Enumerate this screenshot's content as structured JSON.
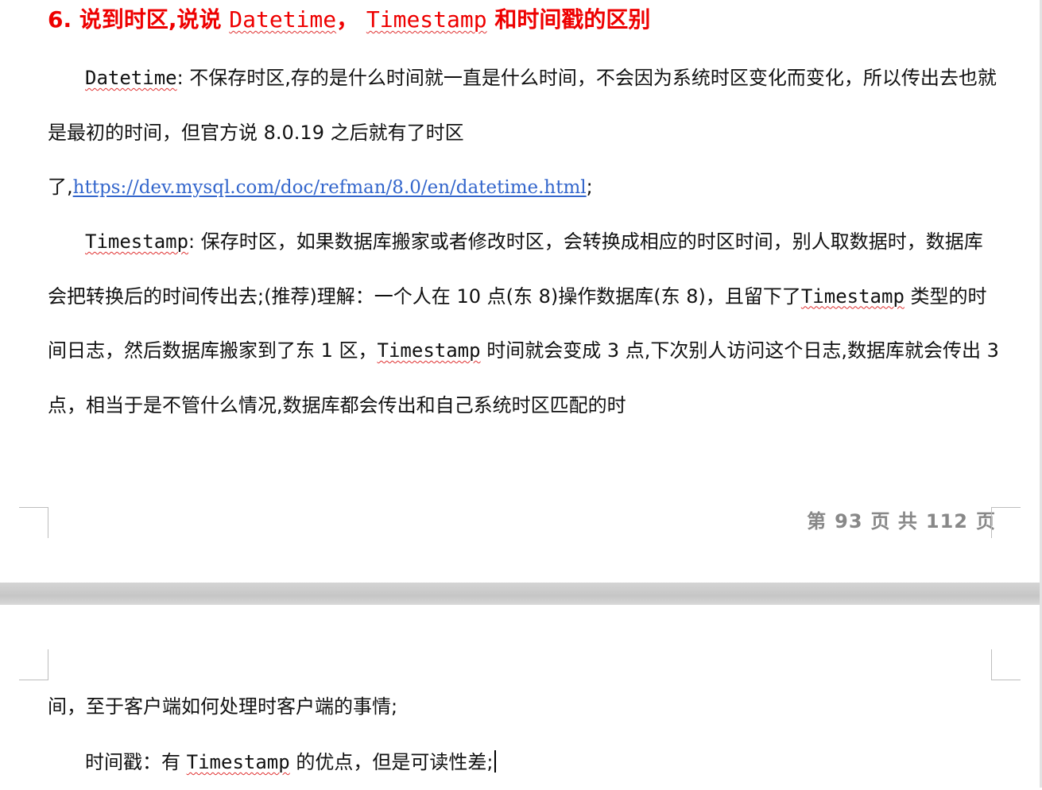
{
  "heading": {
    "number": "6. ",
    "t1": "说到时区,说说 ",
    "c1": "Datetime",
    "t2": "， ",
    "c2": "Timestamp",
    "t3": " 和时间戳的区别"
  },
  "para1": {
    "c1": "Datetime",
    "t1": ": 不保存时区,存的是什么时间就一直是什么时间，不会因为系统时区变化而变化，所以传出去也就是最初的时间，但官方说 8.0.19 之后就有了时区"
  },
  "para2": {
    "t1": "了,",
    "link": "https://dev.mysql.com/doc/refman/8.0/en/datetime.html",
    "t2": ";"
  },
  "para3": {
    "c1": "Timestamp",
    "t1": ": 保存时区，如果数据库搬家或者修改时区，会转换成相应的时区时间，别人取数据时，数据库会把转换后的时间传出去;(推荐)理解：一个人在 10 点(东 8)操作数据库(东 8)，且留下了",
    "c2": "Timestamp",
    "t2": " 类型的时间日志，然后数据库搬家到了东 1 区，",
    "c3": "Timestamp",
    "t3": " 时间就会变成 3 点,下次别人访问这个日志,数据库就会传出 3 点，相当于是不管什么情况,数据库都会传出和自己系统时区匹配的时"
  },
  "footer": {
    "prefix": "第",
    "page": "93",
    "mid": "页 共",
    "total": "112",
    "suffix": "页"
  },
  "para4": {
    "t1": "间，至于客户端如何处理时客户端的事情;"
  },
  "para5": {
    "t1": "时间戳：有 ",
    "c1": "Timestamp",
    "t2": " 的优点，但是可读性差;"
  },
  "colors": {
    "heading": "#ee0000",
    "link": "#3366cc",
    "footer": "#888888",
    "page_gap": "#cccccc"
  }
}
